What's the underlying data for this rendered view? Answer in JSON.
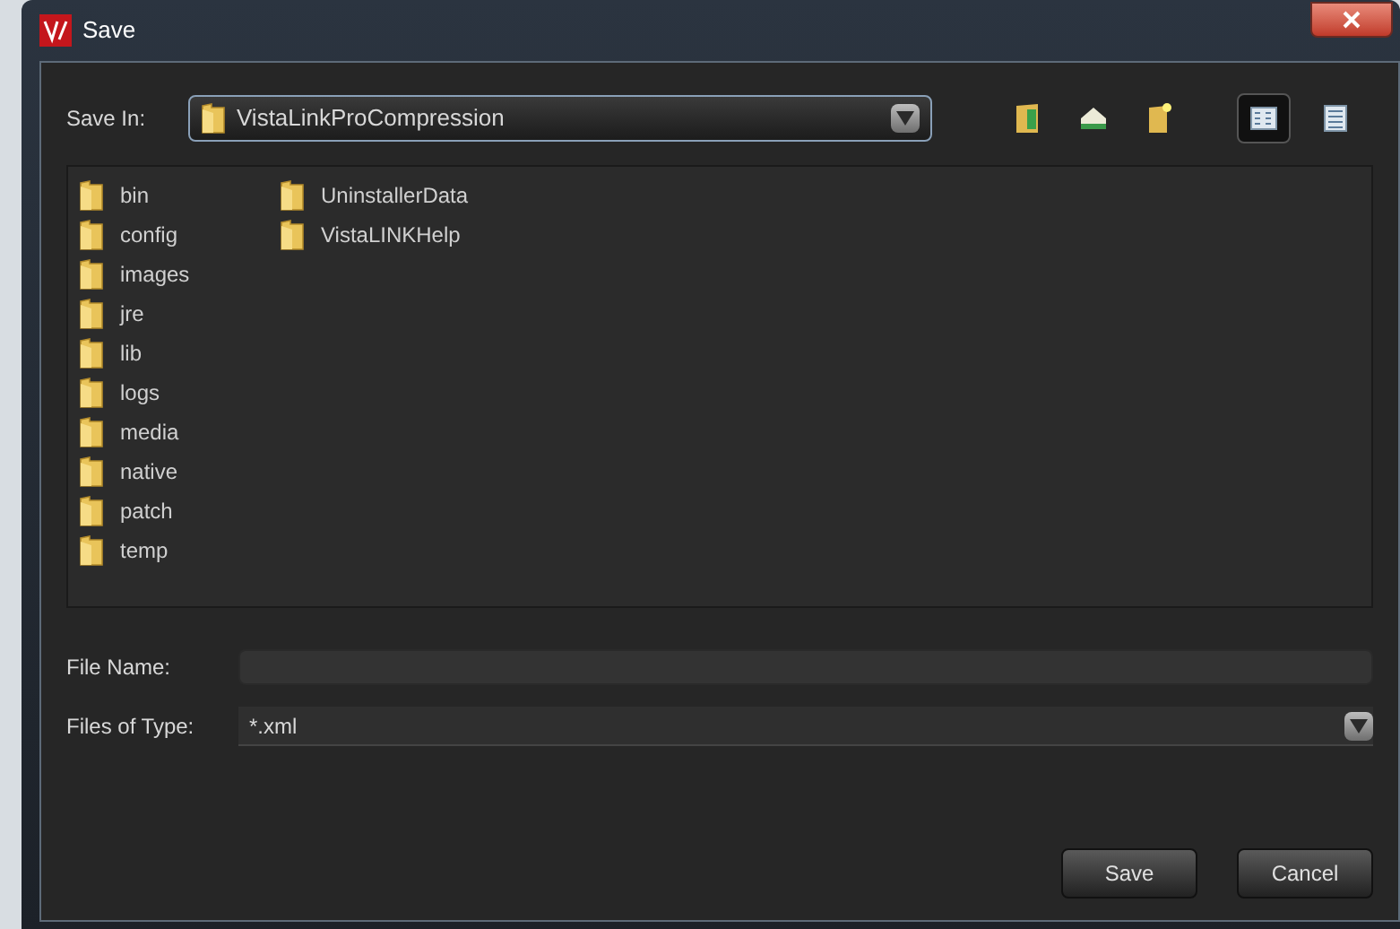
{
  "window": {
    "title": "Save"
  },
  "save_in": {
    "label": "Save In:",
    "value": "VistaLinkProCompression"
  },
  "views": [
    {
      "kind": "list",
      "selected": true
    },
    {
      "kind": "details",
      "selected": false
    }
  ],
  "files": [
    {
      "name": "bin"
    },
    {
      "name": "config"
    },
    {
      "name": "images"
    },
    {
      "name": "jre"
    },
    {
      "name": "lib"
    },
    {
      "name": "logs"
    },
    {
      "name": "media"
    },
    {
      "name": "native"
    },
    {
      "name": "patch"
    },
    {
      "name": "temp"
    },
    {
      "name": "UninstallerData"
    },
    {
      "name": "VistaLINKHelp"
    }
  ],
  "file_name": {
    "label": "File Name:"
  },
  "file_type": {
    "label": "Files of Type:",
    "value": "*.xml"
  },
  "buttons": [
    "Save",
    "Cancel"
  ]
}
